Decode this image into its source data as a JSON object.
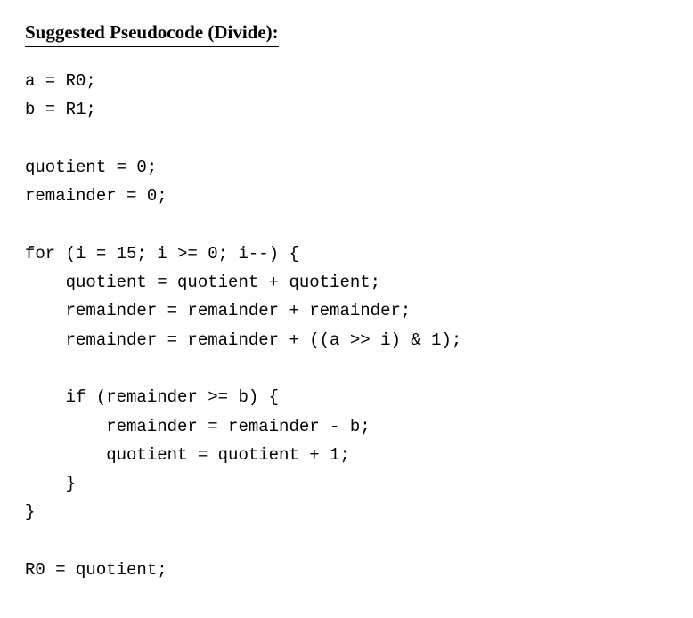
{
  "heading": "Suggested Pseudocode (Divide):",
  "code": {
    "line1": "a = R0;",
    "line2": "b = R1;",
    "line3": "",
    "line4": "quotient = 0;",
    "line5": "remainder = 0;",
    "line6": "",
    "line7": "for (i = 15; i >= 0; i--) {",
    "line8": "    quotient = quotient + quotient;",
    "line9": "    remainder = remainder + remainder;",
    "line10": "    remainder = remainder + ((a >> i) & 1);",
    "line11": "",
    "line12": "    if (remainder >= b) {",
    "line13": "        remainder = remainder - b;",
    "line14": "        quotient = quotient + 1;",
    "line15": "    }",
    "line16": "}",
    "line17": "",
    "line18": "R0 = quotient;"
  }
}
